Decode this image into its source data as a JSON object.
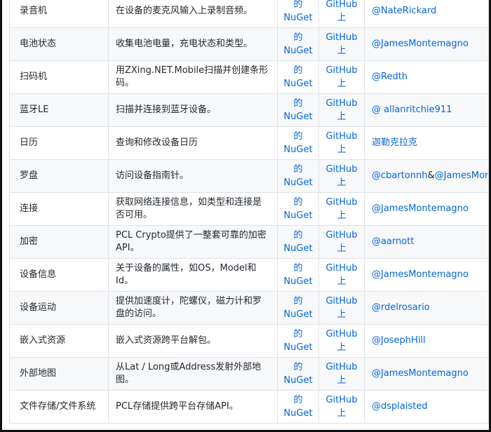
{
  "table": {
    "rows": [
      {
        "name": "录音机",
        "desc": "在设备的麦克风输入上录制音频。",
        "nuget": [
          "的",
          "NuGet"
        ],
        "github": [
          "GitHub",
          "上"
        ],
        "authors": [
          "@NateRickard"
        ]
      },
      {
        "name": "电池状态",
        "desc": "收集电池电量，充电状态和类型。",
        "nuget": [
          "的",
          "NuGet"
        ],
        "github": [
          "GitHub",
          "上"
        ],
        "authors": [
          "@JamesMontemagno"
        ]
      },
      {
        "name": "扫码机",
        "desc": "用ZXing.NET.Mobile扫描并创建条形码。",
        "nuget": [
          "的",
          "NuGet"
        ],
        "github": [
          "GitHub",
          "上"
        ],
        "authors": [
          "@Redth"
        ]
      },
      {
        "name": "蓝牙LE",
        "desc": "扫描并连接到蓝牙设备。",
        "nuget": [
          "的",
          "NuGet"
        ],
        "github": [
          "GitHub",
          "上"
        ],
        "authors": [
          "@ allanritchie911"
        ]
      },
      {
        "name": "日历",
        "desc": "查询和修改设备日历",
        "nuget": [
          "的",
          "NuGet"
        ],
        "github": [
          "GitHub",
          "上"
        ],
        "authors": [
          "迦勒克拉克"
        ]
      },
      {
        "name": "罗盘",
        "desc": "访问设备指南针。",
        "nuget": [
          "的",
          "NuGet"
        ],
        "github": [
          "GitHub",
          "上"
        ],
        "authors": [
          "@cbartonnh",
          "@JamesMontemagno"
        ],
        "sep": "&"
      },
      {
        "name": "连接",
        "desc": "获取网络连接信息，如类型和连接是否可用。",
        "nuget": [
          "的",
          "NuGet"
        ],
        "github": [
          "GitHub",
          "上"
        ],
        "authors": [
          "@JamesMontemagno"
        ]
      },
      {
        "name": "加密",
        "desc": "PCL Crypto提供了一整套可靠的加密API。",
        "nuget": [
          "的",
          "NuGet"
        ],
        "github": [
          "GitHub",
          "上"
        ],
        "authors": [
          "@aarnott"
        ]
      },
      {
        "name": "设备信息",
        "desc": "关于设备的属性，如OS，Model和Id。",
        "nuget": [
          "的",
          "NuGet"
        ],
        "github": [
          "GitHub",
          "上"
        ],
        "authors": [
          "@JamesMontemagno"
        ]
      },
      {
        "name": "设备运动",
        "desc": "提供加速度计，陀螺仪，磁力计和罗盘的访问。",
        "nuget": [
          "的",
          "NuGet"
        ],
        "github": [
          "GitHub",
          "上"
        ],
        "authors": [
          "@rdelrosario"
        ]
      },
      {
        "name": "嵌入式资源",
        "desc": "嵌入式资源跨平台解包。",
        "nuget": [
          "的",
          "NuGet"
        ],
        "github": [
          "GitHub",
          "上"
        ],
        "authors": [
          "@JosephHill"
        ]
      },
      {
        "name": "外部地图",
        "desc": "从Lat / Long或Address发射外部地图。",
        "nuget": [
          "的",
          "NuGet"
        ],
        "github": [
          "GitHub",
          "上"
        ],
        "authors": [
          "@JamesMontemagno"
        ]
      },
      {
        "name": "文件存储/文件系统",
        "desc": "PCL存储提供跨平台存储API。",
        "nuget": [
          "的",
          "NuGet"
        ],
        "github": [
          "GitHub",
          "上"
        ],
        "authors": [
          "@dsplaisted"
        ]
      }
    ]
  }
}
